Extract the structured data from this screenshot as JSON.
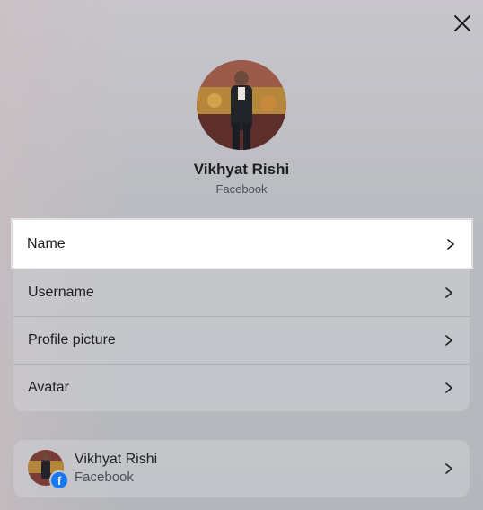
{
  "header": {
    "close_icon": "close-icon"
  },
  "profile": {
    "name": "Vikhyat Rishi",
    "platform": "Facebook",
    "photo_icon": "profile-photo"
  },
  "menu": {
    "items": [
      {
        "label": "Name",
        "icon": "chevron-right-icon",
        "highlighted": true
      },
      {
        "label": "Username",
        "icon": "chevron-right-icon"
      },
      {
        "label": "Profile picture",
        "icon": "chevron-right-icon"
      },
      {
        "label": "Avatar",
        "icon": "chevron-right-icon"
      }
    ]
  },
  "account": {
    "name": "Vikhyat Rishi",
    "platform": "Facebook",
    "badge_icon": "facebook-icon"
  },
  "colors": {
    "facebook_blue": "#1877f2",
    "highlight_bg": "#ffffff"
  }
}
